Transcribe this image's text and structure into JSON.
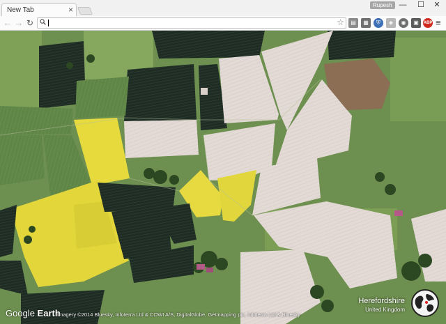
{
  "window": {
    "tab_title": "New Tab",
    "tab_close": "×",
    "profile_name": "Rupesh",
    "minimize": "—",
    "maximize": "☐",
    "close": "✕"
  },
  "toolbar": {
    "back": "←",
    "forward": "→",
    "reload": "↻",
    "search_glyph": "🔍",
    "address_value": "",
    "bookmark_star": "☆",
    "menu": "≡",
    "extensions": [
      {
        "name": "docs-icon",
        "glyph": "▤"
      },
      {
        "name": "photos-icon",
        "glyph": "▦"
      },
      {
        "name": "shield-extension-icon",
        "glyph": "⛨"
      },
      {
        "name": "vpn-extension-icon",
        "glyph": "◈"
      },
      {
        "name": "camera-extension-icon",
        "glyph": "◉"
      },
      {
        "name": "window-extension-icon",
        "glyph": "▣"
      },
      {
        "name": "adblock-icon",
        "glyph": "ABP"
      }
    ]
  },
  "map": {
    "brand_prefix": "Google",
    "brand_suffix": "Earth",
    "attribution": "Imagery ©2014 Bluesky, Infoterra Ltd & COWI A/S, DigitalGlobe, Getmapping plc, Infoterra Ltd & Bluesky",
    "place_name": "Herefordshire",
    "place_country": "United Kingdom"
  },
  "colors": {
    "grass": "#6d8f4f",
    "grass_light": "#8fae62",
    "rapeseed": "#e4d93c",
    "dark_field": "#1f2f27",
    "pale_field": "#e2d8d4",
    "beige_field": "#d8ccc6",
    "hedge": "#2f4a22"
  }
}
